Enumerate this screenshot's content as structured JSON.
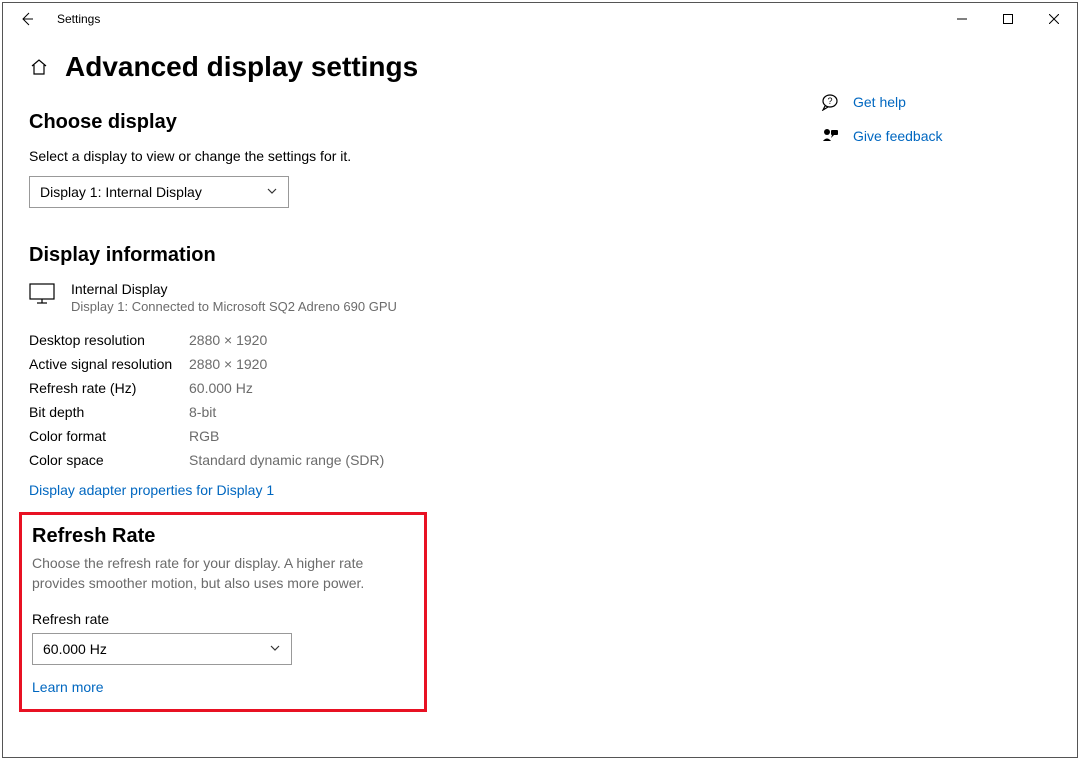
{
  "window": {
    "title": "Settings"
  },
  "page": {
    "title": "Advanced display settings"
  },
  "choose": {
    "heading": "Choose display",
    "sub": "Select a display to view or change the settings for it.",
    "selected": "Display 1: Internal Display"
  },
  "info": {
    "heading": "Display information",
    "display_name": "Internal Display",
    "display_desc": "Display 1: Connected to Microsoft SQ2 Adreno 690 GPU",
    "rows": [
      {
        "label": "Desktop resolution",
        "value": "2880 × 1920"
      },
      {
        "label": "Active signal resolution",
        "value": "2880 × 1920"
      },
      {
        "label": "Refresh rate (Hz)",
        "value": "60.000 Hz"
      },
      {
        "label": "Bit depth",
        "value": "8-bit"
      },
      {
        "label": "Color format",
        "value": "RGB"
      },
      {
        "label": "Color space",
        "value": "Standard dynamic range (SDR)"
      }
    ],
    "adapter_link": "Display adapter properties for Display 1"
  },
  "refresh": {
    "heading": "Refresh Rate",
    "desc": "Choose the refresh rate for your display. A higher rate provides smoother motion, but also uses more power.",
    "field_label": "Refresh rate",
    "selected": "60.000 Hz",
    "learn_more": "Learn more"
  },
  "side": {
    "help": "Get help",
    "feedback": "Give feedback"
  }
}
